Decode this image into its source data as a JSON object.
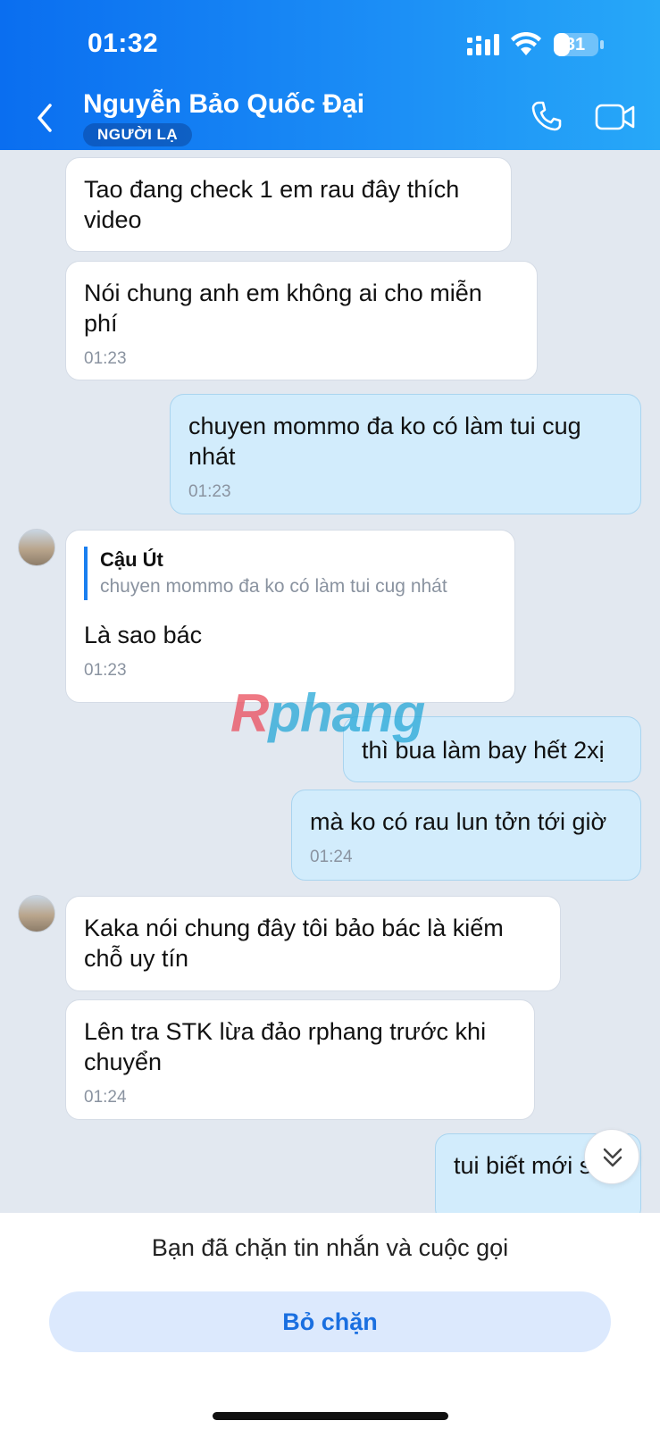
{
  "status_bar": {
    "time": "01:32",
    "battery": "31"
  },
  "header": {
    "contact_name": "Nguyễn Bảo Quốc Đại",
    "badge": "NGƯỜI LẠ"
  },
  "messages": [
    {
      "dir": "in",
      "text": "Tao đang check 1 em rau đây thích video"
    },
    {
      "dir": "in",
      "text": "Nói chung anh em không ai cho miễn phí",
      "time": "01:23"
    },
    {
      "dir": "out",
      "text": "chuyen mommo đa ko có làm tui cug nhát",
      "time": "01:23"
    },
    {
      "dir": "in",
      "quote_author": "Cậu Út",
      "quote_text": "chuyen mommo đa ko có làm tui cug nhát",
      "text": "Là sao bác",
      "time": "01:23"
    },
    {
      "dir": "out",
      "text": "thì bua làm bay hết 2xị"
    },
    {
      "dir": "out",
      "text": "mà ko có rau lun tởn tới giờ",
      "time": "01:24"
    },
    {
      "dir": "in",
      "text": "Kaka nói chung đây tôi bảo bác là kiếm chỗ uy tín"
    },
    {
      "dir": "in",
      "text": "Lên tra STK lừa đảo rphang trước khi chuyển",
      "time": "01:24"
    },
    {
      "dir": "out",
      "text": "tui biết mới sợ"
    }
  ],
  "watermark": {
    "part1": "R",
    "part2": "phang"
  },
  "footer": {
    "blocked_text": "Bạn đã chặn tin nhắn và cuộc gọi",
    "unblock_label": "Bỏ chặn"
  },
  "icons": [
    "signal-icon",
    "wifi-icon",
    "battery-icon",
    "back-icon",
    "phone-icon",
    "video-call-icon",
    "chevron-double-down-icon"
  ]
}
